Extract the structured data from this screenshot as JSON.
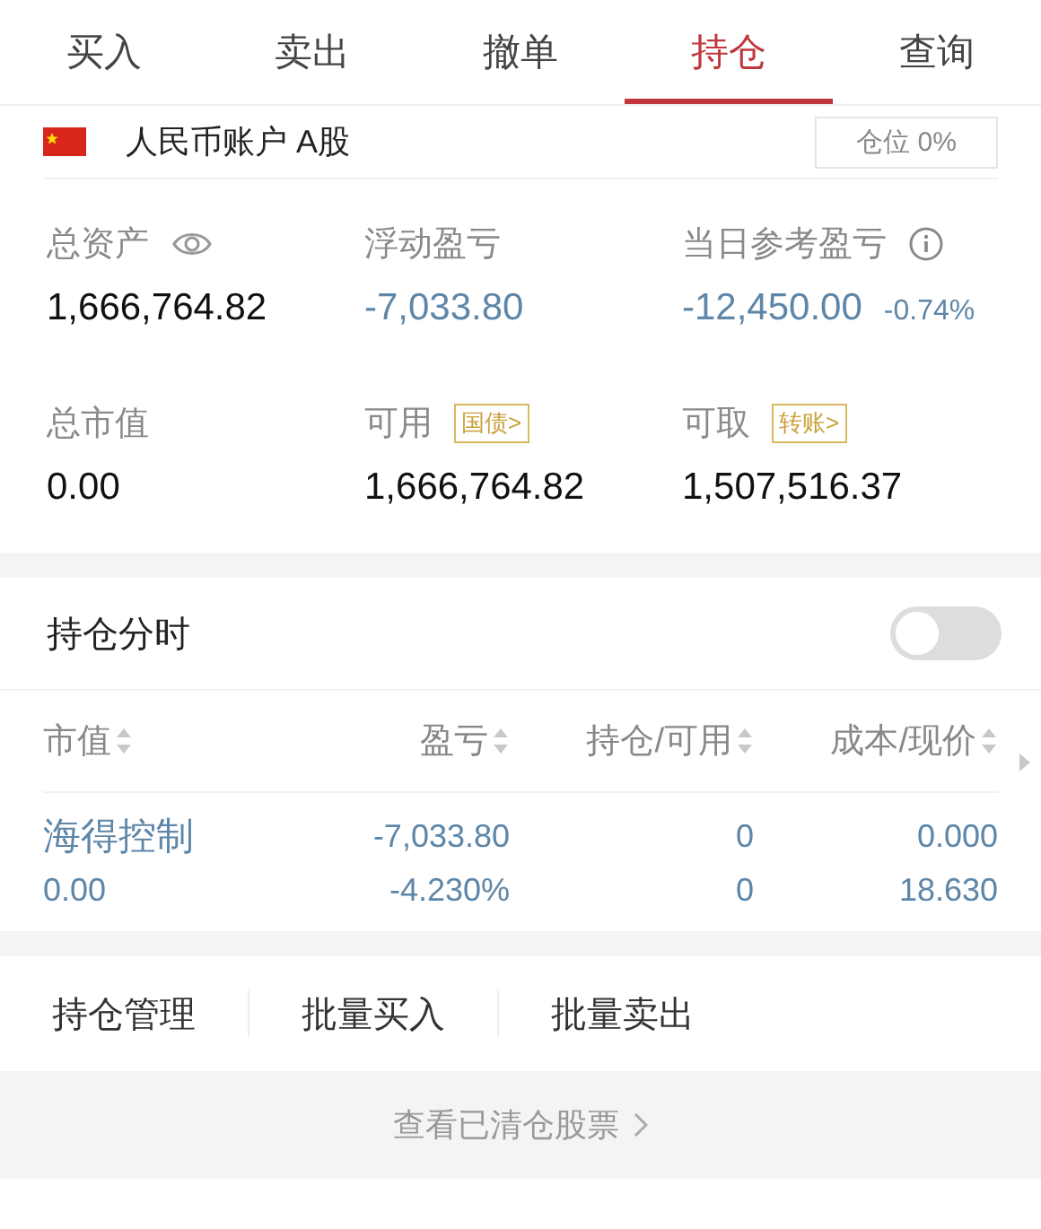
{
  "tabs": [
    {
      "label": "买入",
      "selected": false
    },
    {
      "label": "卖出",
      "selected": false
    },
    {
      "label": "撤单",
      "selected": false
    },
    {
      "label": "持仓",
      "selected": true
    },
    {
      "label": "查询",
      "selected": false
    }
  ],
  "account": {
    "name": "人民币账户 A股",
    "position": "仓位 0%"
  },
  "metrics": [
    {
      "label": "总资产",
      "value": "1,666,764.82",
      "color": "#111111"
    },
    {
      "label": "浮动盈亏",
      "value": "-7,033.80",
      "color": "#5d86a8"
    },
    {
      "label": "当日参考盈亏",
      "value": "-12,450.00",
      "change": "-0.74%",
      "color": "#5d86a8"
    },
    {
      "label": "总市值",
      "value": "0.00",
      "color": "#111111"
    },
    {
      "label": "可用",
      "tag": "国债>",
      "value": "1,666,764.82",
      "color": "#111111"
    },
    {
      "label": "可取",
      "tag": "转账>",
      "value": "1,507,516.37",
      "color": "#111111"
    }
  ],
  "intraday_toggle": {
    "label": "持仓分时",
    "on": false
  },
  "table": {
    "columns": [
      "市值",
      "盈亏",
      "持仓/可用",
      "成本/现价"
    ],
    "rows": [
      {
        "name": "海得控制",
        "market_value": "0.00",
        "pnl": "-7,033.80",
        "pnl_pct": "-4.230%",
        "holding": "0",
        "available": "0",
        "cost": "0.000",
        "price": "18.630",
        "color": "#5d86a8"
      }
    ]
  },
  "actions": [
    "持仓管理",
    "批量买入",
    "批量卖出"
  ],
  "footer_link": "查看已清仓股票"
}
